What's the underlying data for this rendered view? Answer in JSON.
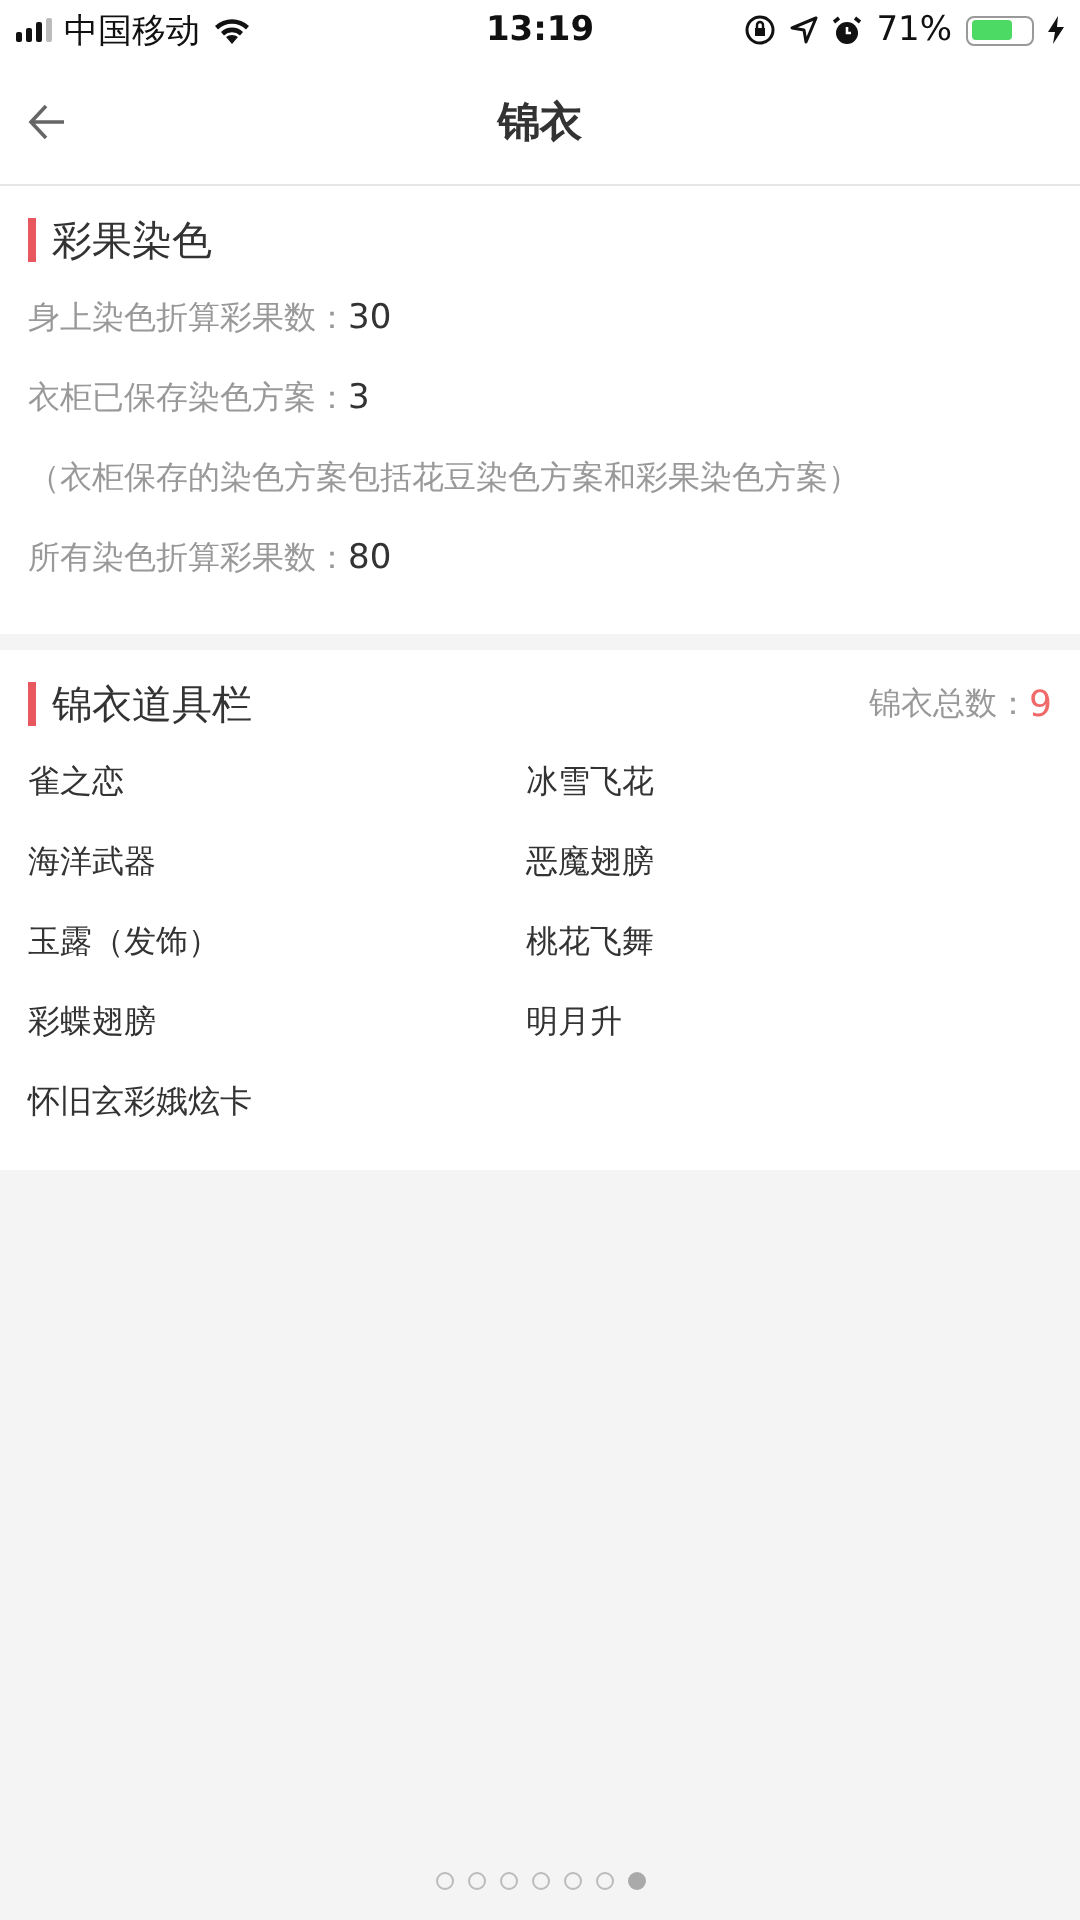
{
  "status_bar": {
    "carrier": "中国移动",
    "time": "13:19",
    "battery_percent": "71%"
  },
  "nav": {
    "title": "锦衣"
  },
  "dye_section": {
    "title": "彩果染色",
    "stats": [
      {
        "label": "身上染色折算彩果数：",
        "value": "30"
      },
      {
        "label": "衣柜已保存染色方案：",
        "value": "3"
      }
    ],
    "note": "（衣柜保存的染色方案包括花豆染色方案和彩果染色方案）",
    "total": {
      "label": "所有染色折算彩果数：",
      "value": "80"
    }
  },
  "items_section": {
    "title": "锦衣道具栏",
    "count_label": "锦衣总数：",
    "count_value": "9",
    "items": [
      "雀之恋",
      "冰雪飞花",
      "海洋武器",
      "恶魔翅膀",
      "玉露（发饰）",
      "桃花飞舞",
      "彩蝶翅膀",
      "明月升",
      "怀旧玄彩娥炫卡"
    ]
  },
  "page_dots": [
    {
      "selected": false
    },
    {
      "selected": false
    },
    {
      "selected": false
    },
    {
      "selected": false
    },
    {
      "selected": false
    },
    {
      "selected": false
    },
    {
      "selected": true
    }
  ]
}
